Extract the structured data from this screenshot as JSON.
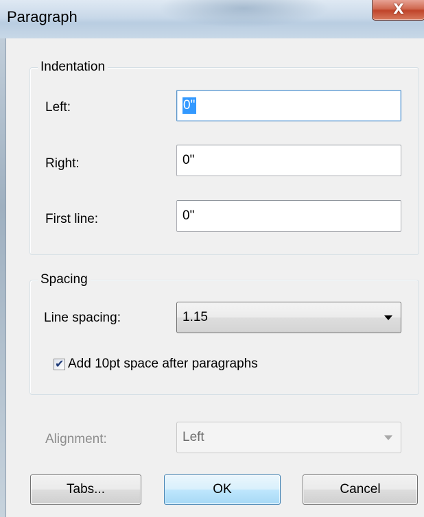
{
  "window": {
    "title": "Paragraph",
    "close_glyph": "X"
  },
  "indentation": {
    "title": "Indentation",
    "left_label": "Left:",
    "left_value": "0\"",
    "right_label": "Right:",
    "right_value": "0\"",
    "first_line_label": "First line:",
    "first_line_value": "0\""
  },
  "spacing": {
    "title": "Spacing",
    "line_spacing_label": "Line spacing:",
    "line_spacing_value": "1.15",
    "add_space_label": "Add 10pt space after paragraphs",
    "add_space_checked": true
  },
  "alignment": {
    "label": "Alignment:",
    "value": "Left",
    "disabled": true
  },
  "buttons": {
    "tabs_label": "Tabs...",
    "ok_label": "OK",
    "cancel_label": "Cancel"
  },
  "icons": {
    "close": "close-icon",
    "checkbox": "check-icon",
    "dropdown": "chevron-down-icon"
  },
  "colors": {
    "selection": "#3399ff",
    "close_button": "#c0442a",
    "default_button_border": "#3c7fb1",
    "disabled_text": "#8d8d8d"
  }
}
